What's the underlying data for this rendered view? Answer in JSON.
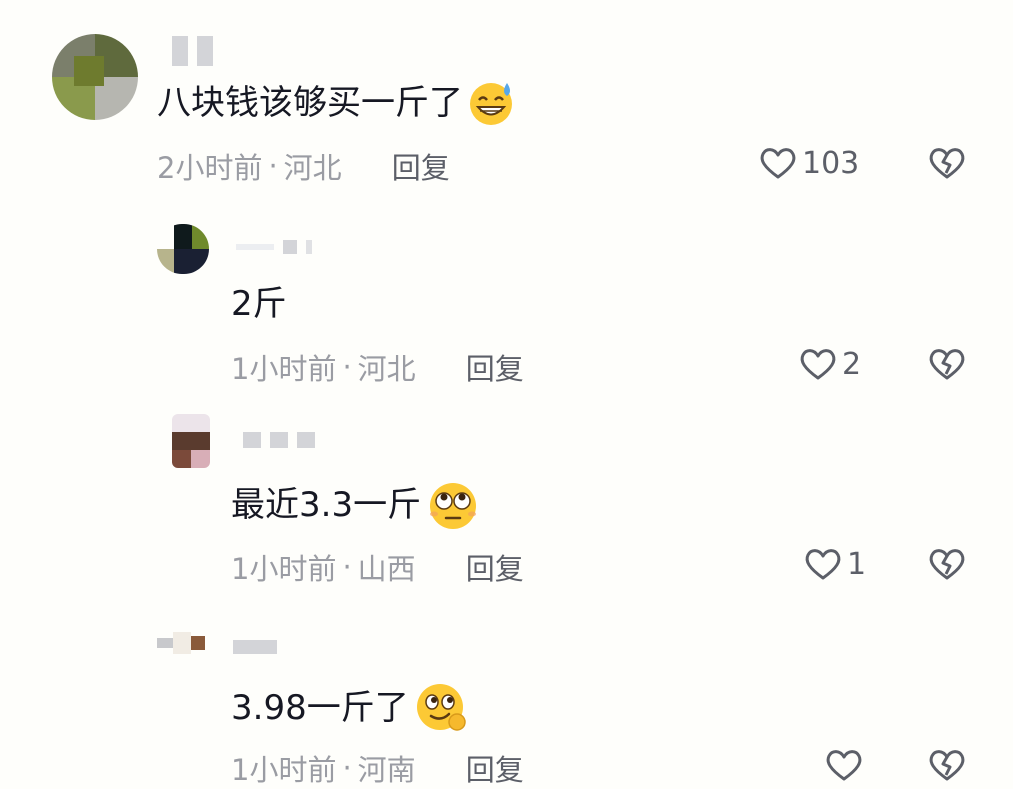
{
  "comments": [
    {
      "text": "八块钱该够买一斤了",
      "emoji": "grinning-sweat-emoji",
      "time": "2小时前",
      "location": "河北",
      "reply_label": "回复",
      "likes": "103"
    },
    {
      "text": "2斤",
      "emoji": "",
      "time": "1小时前",
      "location": "河北",
      "reply_label": "回复",
      "likes": "2"
    },
    {
      "text": "最近3.3一斤",
      "emoji": "eye-roll-emoji",
      "time": "1小时前",
      "location": "山西",
      "reply_label": "回复",
      "likes": "1"
    },
    {
      "text": "3.98一斤了",
      "emoji": "smirk-emoji",
      "time": "1小时前",
      "location": "河南",
      "reply_label": "回复",
      "likes": ""
    }
  ],
  "icons": {
    "like": "heart-outline-icon",
    "dislike": "broken-heart-icon"
  },
  "colors": {
    "background": "#fefefb",
    "text": "#161823",
    "meta": "#9a9ca3",
    "action": "#5c5f68",
    "emoji": "#fcc935"
  }
}
